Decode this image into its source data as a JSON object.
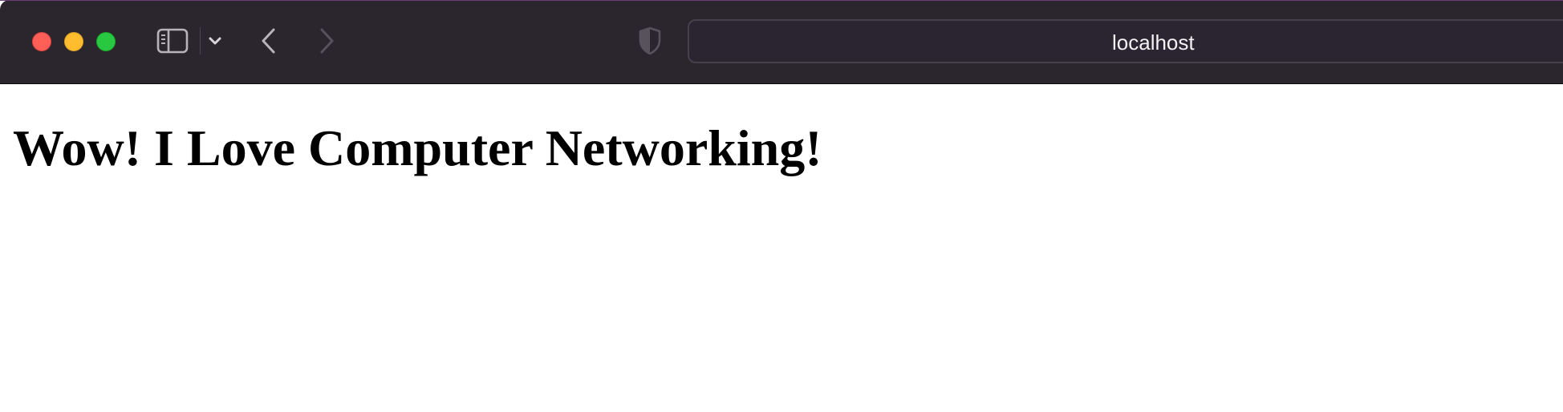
{
  "browser": {
    "traffic_lights": [
      {
        "name": "close",
        "color": "#ff5f57"
      },
      {
        "name": "minimize",
        "color": "#febc2e"
      },
      {
        "name": "maximize",
        "color": "#28c840"
      }
    ],
    "toolbar_icons": [
      "sidebar-icon",
      "chevron-down-icon",
      "back-arrow-icon",
      "forward-arrow-icon",
      "privacy-shield-icon"
    ],
    "address": "localhost",
    "colors": {
      "toolbar_background": "#2b262d",
      "address_bar_background": "#2a2530",
      "page_background": "#ffffff"
    }
  },
  "page": {
    "heading": "Wow! I Love Computer Networking!"
  }
}
